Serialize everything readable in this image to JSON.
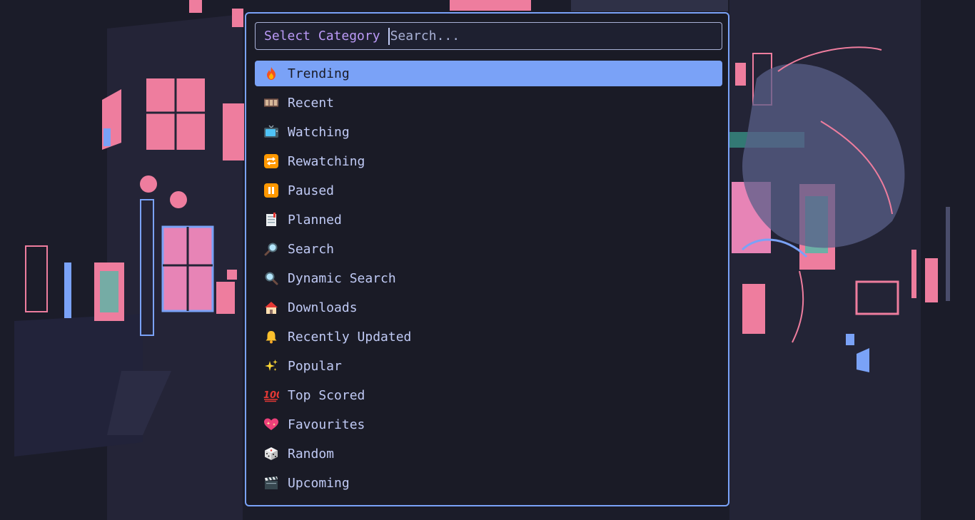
{
  "launcher": {
    "prompt": "Select Category",
    "search_placeholder": "Search...",
    "selected_index": 0,
    "items": [
      {
        "label": "Trending",
        "icon": "fire-icon"
      },
      {
        "label": "Recent",
        "icon": "film-frames-icon"
      },
      {
        "label": "Watching",
        "icon": "television-icon"
      },
      {
        "label": "Rewatching",
        "icon": "repeat-icon"
      },
      {
        "label": "Paused",
        "icon": "pause-icon"
      },
      {
        "label": "Planned",
        "icon": "bookmark-tabs-icon"
      },
      {
        "label": "Search",
        "icon": "magnifier-right-icon"
      },
      {
        "label": "Dynamic Search",
        "icon": "magnifier-left-icon"
      },
      {
        "label": "Downloads",
        "icon": "house-icon"
      },
      {
        "label": "Recently Updated",
        "icon": "bell-icon"
      },
      {
        "label": "Popular",
        "icon": "sparkles-icon"
      },
      {
        "label": "Top Scored",
        "icon": "hundred-points-icon"
      },
      {
        "label": "Favourites",
        "icon": "sparkling-heart-icon"
      },
      {
        "label": "Random",
        "icon": "die-icon"
      },
      {
        "label": "Upcoming",
        "icon": "clapper-board-icon"
      }
    ]
  },
  "colors": {
    "accent": "#7aa2f7",
    "background": "#1a1b26",
    "prompt": "#bb9af7",
    "text": "#c0caf5",
    "wallpaper_pink": "#f07f9c",
    "wallpaper_blue": "#7aa2f7",
    "wallpaper_teal": "#41c0a8"
  }
}
